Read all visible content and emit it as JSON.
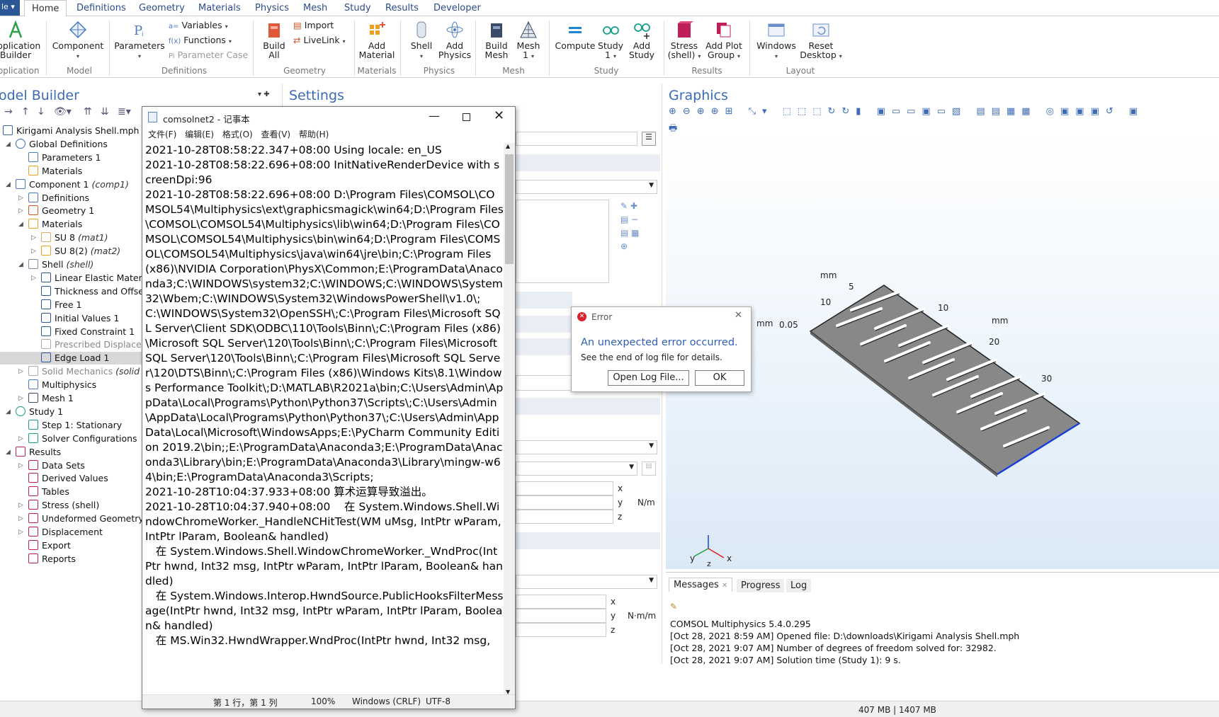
{
  "ribbon": {
    "file_label": "le ▾",
    "tabs": [
      "Home",
      "Definitions",
      "Geometry",
      "Materials",
      "Physics",
      "Mesh",
      "Study",
      "Results",
      "Developer"
    ],
    "app_builder": [
      "pplication",
      "Builder"
    ],
    "component": "Component",
    "parameters": "Parameters",
    "variables": "Variables",
    "functions": "Functions",
    "parameter_case": "Parameter Case",
    "build_all": [
      "Build",
      "All"
    ],
    "import": "Import",
    "livelink": "LiveLink",
    "add_material": [
      "Add",
      "Material"
    ],
    "shell": "Shell",
    "add_physics": [
      "Add",
      "Physics"
    ],
    "build_mesh": [
      "Build",
      "Mesh"
    ],
    "mesh1": [
      "Mesh",
      "1"
    ],
    "compute": "Compute",
    "study1": [
      "Study",
      "1"
    ],
    "add_study": [
      "Add",
      "Study"
    ],
    "stress_shell": [
      "Stress",
      "(shell)"
    ],
    "add_plot_group": [
      "Add Plot",
      "Group"
    ],
    "windows": "Windows",
    "reset_desktop": [
      "Reset",
      "Desktop"
    ],
    "groups": {
      "application": "pplication",
      "model": "Model",
      "definitions": "Definitions",
      "geometry": "Geometry",
      "materials": "Materials",
      "physics": "Physics",
      "mesh": "Mesh",
      "study": "Study",
      "results": "Results",
      "layout": "Layout"
    }
  },
  "panels": {
    "model_builder": "odel Builder",
    "settings": "Settings",
    "graphics": "Graphics"
  },
  "tree": [
    {
      "label": "Kirigami Analysis Shell.mph",
      "tag": "(r"
    },
    {
      "label": "Global Definitions",
      "tag": ""
    },
    {
      "label": "Parameters 1",
      "tag": ""
    },
    {
      "label": "Materials",
      "tag": ""
    },
    {
      "label": "Component 1",
      "tag": "(comp1)"
    },
    {
      "label": "Definitions",
      "tag": ""
    },
    {
      "label": "Geometry 1",
      "tag": ""
    },
    {
      "label": "Materials",
      "tag": ""
    },
    {
      "label": "SU 8",
      "tag": "(mat1)"
    },
    {
      "label": "SU 8(2)",
      "tag": "(mat2)"
    },
    {
      "label": "Shell",
      "tag": "(shell)"
    },
    {
      "label": "Linear Elastic Materi",
      "tag": ""
    },
    {
      "label": "Thickness and Offse",
      "tag": ""
    },
    {
      "label": "Free 1",
      "tag": ""
    },
    {
      "label": "Initial Values 1",
      "tag": ""
    },
    {
      "label": "Fixed Constraint 1",
      "tag": ""
    },
    {
      "label": "Prescribed Displace",
      "tag": ""
    },
    {
      "label": "Edge Load 1",
      "tag": ""
    },
    {
      "label": "Solid Mechanics",
      "tag": "(solid"
    },
    {
      "label": "Multiphysics",
      "tag": ""
    },
    {
      "label": "Mesh 1",
      "tag": ""
    },
    {
      "label": "Study 1",
      "tag": ""
    },
    {
      "label": "Step 1: Stationary",
      "tag": ""
    },
    {
      "label": "Solver Configurations",
      "tag": ""
    },
    {
      "label": "Results",
      "tag": ""
    },
    {
      "label": "Data Sets",
      "tag": ""
    },
    {
      "label": "Derived Values",
      "tag": ""
    },
    {
      "label": "Tables",
      "tag": ""
    },
    {
      "label": "Stress (shell)",
      "tag": ""
    },
    {
      "label": "Undeformed Geometry",
      "tag": ""
    },
    {
      "label": "Displacement",
      "tag": ""
    },
    {
      "label": "Export",
      "tag": ""
    },
    {
      "label": "Reports",
      "tag": ""
    }
  ],
  "settings": {
    "x": "x",
    "y": "y",
    "z": "z",
    "unit1": "N/m",
    "unit2": "N·m/m"
  },
  "notepad": {
    "title": "comsolnet2 - 记事本",
    "menu": [
      "文件(F)",
      "编辑(E)",
      "格式(O)",
      "查看(V)",
      "帮助(H)"
    ],
    "content": "2021-10-28T08:58:22.347+08:00 Using locale: en_US\n2021-10-28T08:58:22.696+08:00 InitNativeRenderDevice with screenDpi:96\n2021-10-28T08:58:22.696+08:00 D:\\Program Files\\COMSOL\\COMSOL54\\Multiphysics\\ext\\graphicsmagick\\win64;D:\\Program Files\\COMSOL\\COMSOL54\\Multiphysics\\lib\\win64;D:\\Program Files\\COMSOL\\COMSOL54\\Multiphysics\\bin\\win64;D:\\Program Files\\COMSOL\\COMSOL54\\Multiphysics\\java\\win64\\jre\\bin;C:\\Program Files (x86)\\NVIDIA Corporation\\PhysX\\Common;E:\\ProgramData\\Anaconda3;C:\\WINDOWS\\system32;C:\\WINDOWS;C:\\WINDOWS\\System32\\Wbem;C:\\WINDOWS\\System32\\WindowsPowerShell\\v1.0\\;C:\\WINDOWS\\System32\\OpenSSH\\;C:\\Program Files\\Microsoft SQL Server\\Client SDK\\ODBC\\110\\Tools\\Binn\\;C:\\Program Files (x86)\\Microsoft SQL Server\\120\\Tools\\Binn\\;C:\\Program Files\\Microsoft SQL Server\\120\\Tools\\Binn\\;C:\\Program Files\\Microsoft SQL Server\\120\\DTS\\Binn\\;C:\\Program Files (x86)\\Windows Kits\\8.1\\Windows Performance Toolkit\\;D:\\MATLAB\\R2021a\\bin;C:\\Users\\Admin\\AppData\\Local\\Programs\\Python\\Python37\\Scripts\\;C:\\Users\\Admin\\AppData\\Local\\Programs\\Python\\Python37\\;C:\\Users\\Admin\\AppData\\Local\\Microsoft\\WindowsApps;E:\\PyCharm Community Edition 2019.2\\bin;;E:\\ProgramData\\Anaconda3;E:\\ProgramData\\Anaconda3\\Library\\bin;E:\\ProgramData\\Anaconda3\\Library\\mingw-w64\\bin;E:\\ProgramData\\Anaconda3\\Scripts;\n2021-10-28T10:04:37.933+08:00 算术运算导致溢出。\n2021-10-28T10:04:37.940+08:00    在 System.Windows.Shell.WindowChromeWorker._HandleNCHitTest(WM uMsg, IntPtr wParam, IntPtr lParam, Boolean& handled)\n   在 System.Windows.Shell.WindowChromeWorker._WndProc(IntPtr hwnd, Int32 msg, IntPtr wParam, IntPtr lParam, Boolean& handled)\n   在 System.Windows.Interop.HwndSource.PublicHooksFilterMessage(IntPtr hwnd, Int32 msg, IntPtr wParam, IntPtr lParam, Boolean& handled)\n   在 MS.Win32.HwndWrapper.WndProc(IntPtr hwnd, Int32 msg,",
    "status": {
      "position": "第 1 行，第 1 列",
      "zoom": "100%",
      "eol": "Windows (CRLF)",
      "encoding": "UTF-8"
    }
  },
  "error_dialog": {
    "title": "Error",
    "heading": "An unexpected error occurred.",
    "detail": "See the end of log file for details.",
    "open_log": "Open Log File...",
    "ok": "OK"
  },
  "graphics": {
    "labels": {
      "mm_top": "mm",
      "t5": "5",
      "t10a": "10",
      "t10b": "10",
      "mm_right": "mm",
      "mm_left": "mm",
      "t005": "0.05",
      "t20": "20",
      "t30": "30"
    },
    "axes": {
      "x": "x",
      "y": "y",
      "z": "z"
    }
  },
  "messages": {
    "tabs": [
      "Messages",
      "Progress",
      "Log"
    ],
    "lines": [
      "COMSOL Multiphysics 5.4.0.295",
      "[Oct 28, 2021 8:59 AM] Opened file: D:\\downloads\\Kirigami Analysis Shell.mph",
      "[Oct 28, 2021 9:07 AM] Number of degrees of freedom solved for: 32982.",
      "[Oct 28, 2021 9:07 AM] Solution time (Study 1): 9 s."
    ]
  },
  "status_bar": {
    "memory": "407 MB | 1407 MB"
  }
}
